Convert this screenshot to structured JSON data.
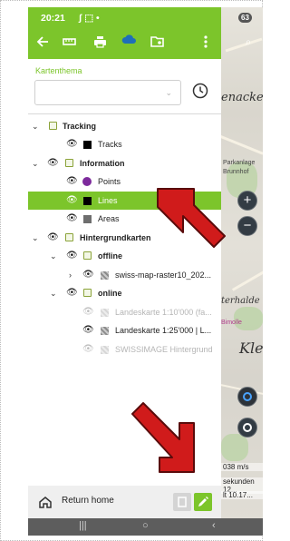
{
  "status_bar": {
    "time": "20:21",
    "left_icons": "ʃ ⬚ •",
    "battery": "63"
  },
  "toolbar": {
    "icons": [
      "back-arrow-icon",
      "ruler-icon",
      "print-icon",
      "cloud-icon",
      "folder-settings-icon",
      "more-vert-icon"
    ]
  },
  "kartenthema": {
    "label": "Kartenthema",
    "selected_value": ""
  },
  "tree": [
    {
      "id": "tracking",
      "label": "Tracking",
      "level": 0,
      "caret": "⌄",
      "bold": true,
      "folder": true,
      "eye": false
    },
    {
      "id": "tracks",
      "label": "Tracks",
      "level": 1,
      "swatch": "black",
      "eye": true
    },
    {
      "id": "information",
      "label": "Information",
      "level": 0,
      "caret": "⌄",
      "bold": true,
      "folder": true,
      "eye": true
    },
    {
      "id": "points",
      "label": "Points",
      "level": 1,
      "swatch": "purple",
      "eye": true
    },
    {
      "id": "lines",
      "label": "Lines",
      "level": 1,
      "swatch": "black",
      "eye": true,
      "selected": true
    },
    {
      "id": "areas",
      "label": "Areas",
      "level": 1,
      "swatch": "gray",
      "eye": true
    },
    {
      "id": "hintergrundkarten",
      "label": "Hintergrundkarten",
      "level": 0,
      "caret": "⌄",
      "bold": true,
      "folder": true,
      "eye": true
    },
    {
      "id": "offline",
      "label": "offline",
      "level": 1,
      "caret": "⌄",
      "bold": true,
      "folder": true,
      "eye": true
    },
    {
      "id": "swiss-map",
      "label": "swiss-map-raster10_202...",
      "level": 2,
      "caret": "›",
      "swatch": "tex",
      "eye": true
    },
    {
      "id": "online",
      "label": "online",
      "level": 1,
      "caret": "⌄",
      "bold": true,
      "folder": true,
      "eye": true
    },
    {
      "id": "lk10",
      "label": "Landeskarte 1:10'000 (fa...",
      "level": 2,
      "swatch": "tex-dim",
      "eye": "dim",
      "dim": true
    },
    {
      "id": "lk25",
      "label": "Landeskarte 1:25'000 | L...",
      "level": 2,
      "swatch": "tex",
      "eye": true
    },
    {
      "id": "swissimage",
      "label": "SWISSIMAGE Hintergrund",
      "level": 2,
      "swatch": "tex-dim",
      "eye": "dim",
      "dim": true
    }
  ],
  "bottom": {
    "return_label": "Return home"
  },
  "map": {
    "labels": [
      "enacker",
      "Parkanlage",
      "Brunnhof",
      "terhalde",
      "Kle",
      "Bimolle"
    ],
    "stats": [
      "038 m/s",
      "sekunden 12...",
      "lt 10.17..."
    ]
  },
  "colors": {
    "accent": "#7cc52b",
    "arrow": "#d01b1b"
  }
}
